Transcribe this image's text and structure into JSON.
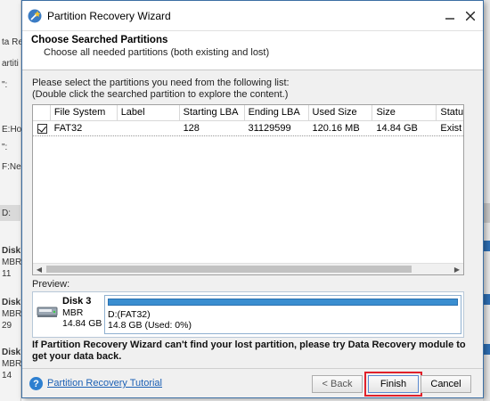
{
  "background": {
    "left_fragments": [
      "ta Reco",
      "artiti",
      "\":",
      "E:Ho",
      "\":",
      "F:Ne",
      "D:",
      "Disk",
      "MBR",
      "11",
      "Disk",
      "MBR",
      "29",
      "Disk",
      "MBR",
      "14"
    ]
  },
  "window": {
    "title": "Partition Recovery Wizard",
    "minimize_icon": "window-minimize-icon",
    "close_icon": "window-close-icon"
  },
  "header": {
    "title": "Choose Searched Partitions",
    "subtitle": "Choose all needed partitions (both existing and lost)"
  },
  "instructions": {
    "line1": "Please select the partitions you need from the following list:",
    "line2": "(Double click the searched partition to explore the content.)"
  },
  "table": {
    "columns": [
      "File System",
      "Label",
      "Starting LBA",
      "Ending LBA",
      "Used Size",
      "Size",
      "Statu"
    ],
    "rows": [
      {
        "checked": true,
        "file_system": "FAT32",
        "label": "",
        "starting_lba": "128",
        "ending_lba": "31129599",
        "used_size": "120.16 MB",
        "size": "14.84 GB",
        "status": "Exist"
      }
    ]
  },
  "preview": {
    "label": "Preview:",
    "disk_name": "Disk 3",
    "disk_type": "MBR",
    "disk_size": "14.84 GB",
    "partition_name": "D:(FAT32)",
    "partition_detail": "14.8 GB (Used: 0%)"
  },
  "note": "If Partition Recovery Wizard can't find your lost partition, please try Data Recovery module to get your data back.",
  "footer": {
    "help_link": "Partition Recovery Tutorial",
    "back_label": "< Back",
    "finish_label": "Finish",
    "cancel_label": "Cancel"
  },
  "colors": {
    "accent": "#3a8ed0",
    "link": "#1a5fb4",
    "highlight": "#e0202a"
  }
}
